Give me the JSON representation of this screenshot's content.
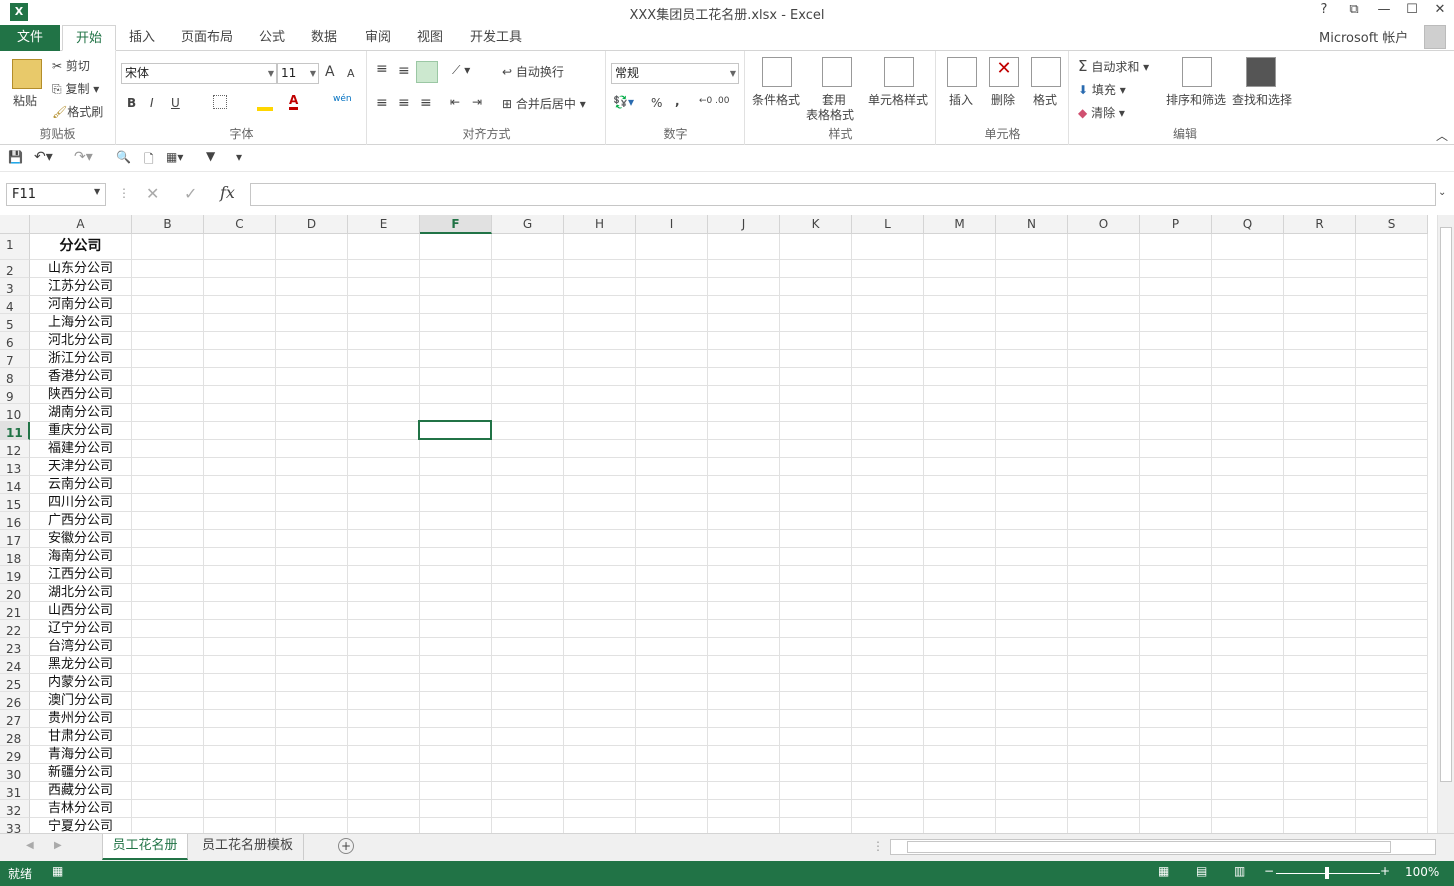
{
  "window": {
    "title": "XXX集团员工花名册.xlsx - Excel",
    "app_icon": "X",
    "help": "?",
    "restore_ribbon": "⧉",
    "minimize": "—",
    "maximize": "☐",
    "close": "✕"
  },
  "tabs": {
    "file": "文件",
    "items": [
      "开始",
      "插入",
      "页面布局",
      "公式",
      "数据",
      "审阅",
      "视图",
      "开发工具"
    ],
    "active": "开始",
    "account": "Microsoft 帐户"
  },
  "ribbon": {
    "clipboard": {
      "paste": "粘贴",
      "cut": "剪切",
      "copy": "复制",
      "format_painter": "格式刷",
      "label": "剪贴板"
    },
    "font": {
      "name": "宋体",
      "size": "11",
      "bold": "B",
      "italic": "I",
      "underline": "U",
      "grow": "A",
      "shrink": "A",
      "phonetic": "wén",
      "label": "字体"
    },
    "alignment": {
      "wrap": "自动换行",
      "merge": "合并后居中",
      "label": "对齐方式"
    },
    "number": {
      "format": "常规",
      "percent": "%",
      "comma": ",",
      "label": "数字"
    },
    "styles": {
      "conditional": "条件格式",
      "table_1": "套用",
      "table_2": "表格格式",
      "cell_styles": "单元格样式",
      "label": "样式"
    },
    "cells": {
      "insert": "插入",
      "delete": "删除",
      "format": "格式",
      "label": "单元格"
    },
    "editing": {
      "autosum": "自动求和",
      "fill": "填充",
      "clear": "清除",
      "sort": "排序和筛选",
      "find": "查找和选择",
      "label": "编辑"
    }
  },
  "formula_bar": {
    "name_box": "F11",
    "fx": "fx",
    "content": ""
  },
  "columns": [
    "A",
    "B",
    "C",
    "D",
    "E",
    "F",
    "G",
    "H",
    "I",
    "J",
    "K",
    "L",
    "M",
    "N",
    "O",
    "P",
    "Q",
    "R",
    "S"
  ],
  "active_column": "F",
  "active_row": 11,
  "rows": [
    {
      "n": "1",
      "a": "分公司"
    },
    {
      "n": "2",
      "a": "山东分公司"
    },
    {
      "n": "3",
      "a": "江苏分公司"
    },
    {
      "n": "4",
      "a": "河南分公司"
    },
    {
      "n": "5",
      "a": "上海分公司"
    },
    {
      "n": "6",
      "a": "河北分公司"
    },
    {
      "n": "7",
      "a": "浙江分公司"
    },
    {
      "n": "8",
      "a": "香港分公司"
    },
    {
      "n": "9",
      "a": "陕西分公司"
    },
    {
      "n": "10",
      "a": "湖南分公司"
    },
    {
      "n": "11",
      "a": "重庆分公司"
    },
    {
      "n": "12",
      "a": "福建分公司"
    },
    {
      "n": "13",
      "a": "天津分公司"
    },
    {
      "n": "14",
      "a": "云南分公司"
    },
    {
      "n": "15",
      "a": "四川分公司"
    },
    {
      "n": "16",
      "a": "广西分公司"
    },
    {
      "n": "17",
      "a": "安徽分公司"
    },
    {
      "n": "18",
      "a": "海南分公司"
    },
    {
      "n": "19",
      "a": "江西分公司"
    },
    {
      "n": "20",
      "a": "湖北分公司"
    },
    {
      "n": "21",
      "a": "山西分公司"
    },
    {
      "n": "22",
      "a": "辽宁分公司"
    },
    {
      "n": "23",
      "a": "台湾分公司"
    },
    {
      "n": "24",
      "a": "黑龙分公司"
    },
    {
      "n": "25",
      "a": "内蒙分公司"
    },
    {
      "n": "26",
      "a": "澳门分公司"
    },
    {
      "n": "27",
      "a": "贵州分公司"
    },
    {
      "n": "28",
      "a": "甘肃分公司"
    },
    {
      "n": "29",
      "a": "青海分公司"
    },
    {
      "n": "30",
      "a": "新疆分公司"
    },
    {
      "n": "31",
      "a": "西藏分公司"
    },
    {
      "n": "32",
      "a": "吉林分公司"
    },
    {
      "n": "33",
      "a": "宁夏分公司"
    }
  ],
  "sheets": [
    "员工花名册",
    "员工花名册模板"
  ],
  "active_sheet": "员工花名册",
  "status": {
    "ready": "就绪",
    "zoom": "100%"
  },
  "colors": {
    "accent": "#217346"
  }
}
